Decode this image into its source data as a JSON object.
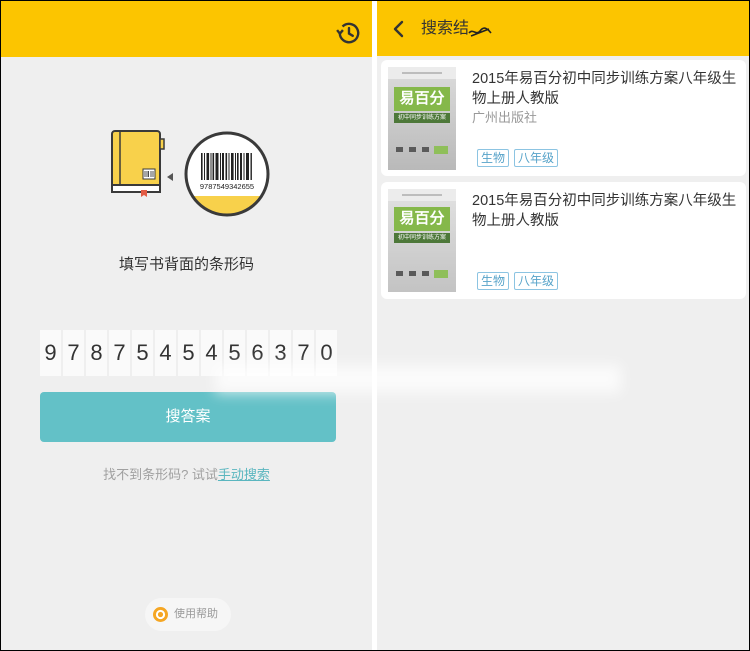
{
  "scan_page": {
    "header": {
      "history_icon": "history-icon"
    },
    "illustration": {
      "barcode_number": "9787549342655"
    },
    "instruction": "填写书背面的条形码",
    "barcode_digits": [
      "9",
      "7",
      "8",
      "7",
      "5",
      "4",
      "5",
      "4",
      "5",
      "6",
      "3",
      "7",
      "0"
    ],
    "search_button": "搜答案",
    "hint_prefix": "找不到条形码? 试试",
    "hint_link": "手动搜索",
    "help_label": "使用帮助",
    "help_icon": "help-icon"
  },
  "results_page": {
    "header": {
      "title": "搜索结",
      "back_icon": "chevron-left-icon"
    },
    "results": [
      {
        "title": "2015年易百分初中同步训练方案八年级生物上册人教版",
        "publisher": "广州出版社",
        "tags": [
          "生物",
          "八年级"
        ],
        "cover": {
          "brand": "易百分",
          "subtitle": "初中同步训练方案"
        }
      },
      {
        "title": "2015年易百分初中同步训练方案八年级生物上册人教版",
        "tags": [
          "生物",
          "八年级"
        ],
        "cover": {
          "brand": "易百分",
          "subtitle": "初中同步训练方案"
        }
      }
    ]
  },
  "colors": {
    "header_yellow": "#fcc500",
    "background": "#efefef",
    "button_teal": "#63c1c7",
    "link_teal": "#5ab6bf",
    "tag_blue": "#57a3c9",
    "book_yellow": "#f8d14b"
  }
}
